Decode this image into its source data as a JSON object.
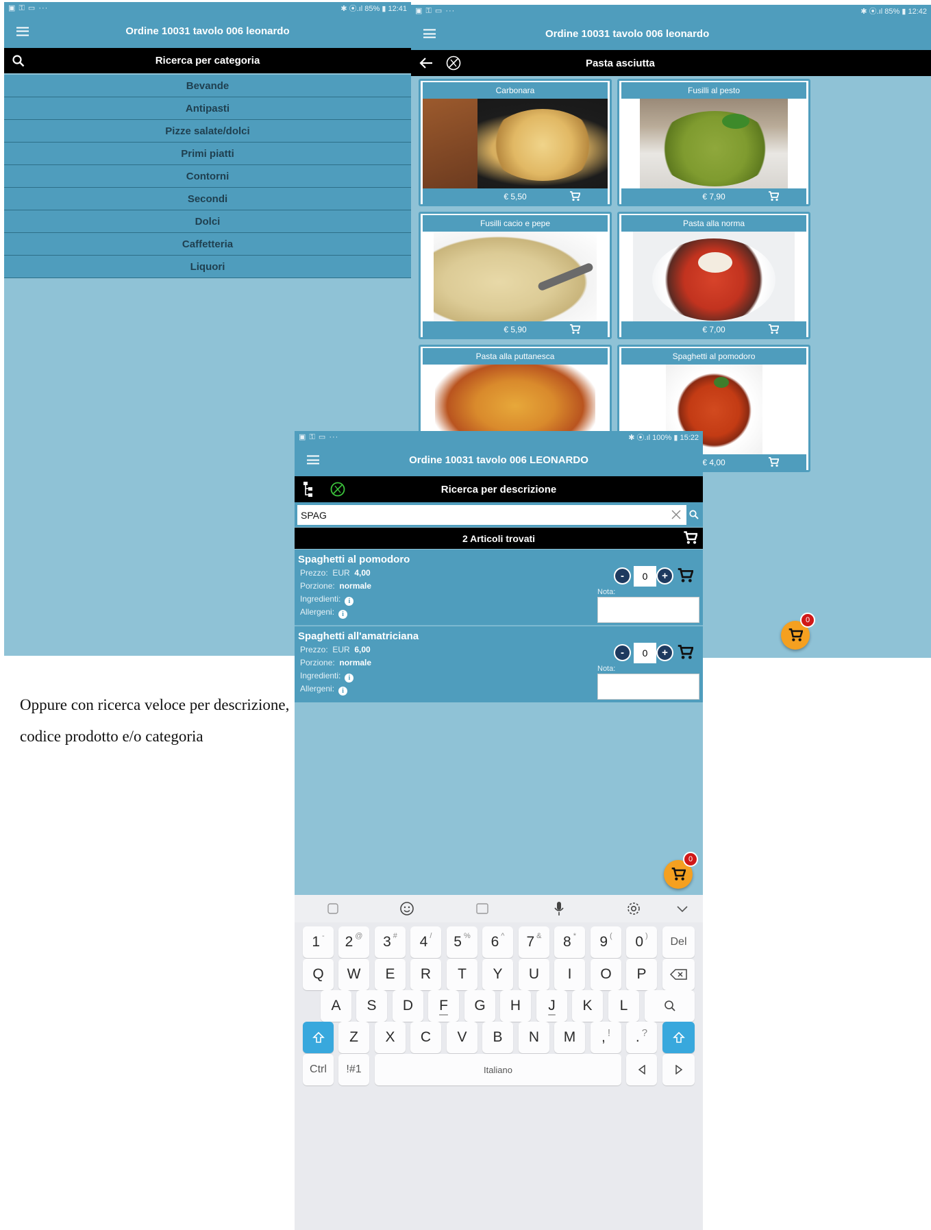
{
  "screen1": {
    "status_left": "▣ ⚿ ▭ ···",
    "status_right": "✱ ⦿.ıl 85% ▮ 12:41",
    "title": "Ordine 10031 tavolo 006 leonardo",
    "subheader": "Ricerca per categoria",
    "categories": [
      "Bevande",
      "Antipasti",
      "Pizze salate/dolci",
      "Primi piatti",
      "Contorni",
      "Secondi",
      "Dolci",
      "Caffetteria",
      "Liquori"
    ]
  },
  "screen2": {
    "status_left": "▣ ⚿ ▭ ···",
    "status_right": "✱ ⦿.ıl 85% ▮ 12:42",
    "title": "Ordine 10031 tavolo 006 leonardo",
    "subheader": "Pasta asciutta",
    "products": [
      {
        "name": "Carbonara",
        "price": "€ 5,50"
      },
      {
        "name": "Fusilli al pesto",
        "price": "€ 7,90"
      },
      {
        "name": "Fusilli cacio e pepe",
        "price": "€ 5,90"
      },
      {
        "name": "Pasta alla norma",
        "price": "€ 7,00"
      },
      {
        "name": "Pasta alla puttanesca",
        "price": ""
      },
      {
        "name": "Spaghetti al pomodoro",
        "price": "€ 4,00"
      }
    ],
    "cart_count": "0"
  },
  "screen3": {
    "status_left": "▣ ⚿ ▭ ···",
    "status_right": "✱ ⦿.ıl 100% ▮ 15:22",
    "title": "Ordine 10031 tavolo 006 LEONARDO",
    "subheader": "Ricerca per descrizione",
    "search_value": "SPAG",
    "results_label": "2 Articoli trovati",
    "results": [
      {
        "name": "Spaghetti al pomodoro",
        "price_label": "Prezzo:",
        "currency": "EUR",
        "price": "4,00",
        "portion_label": "Porzione:",
        "portion": "normale",
        "ingredients_label": "Ingredienti:",
        "allergens_label": "Allergeni:",
        "qty": "0",
        "note_label": "Nota:"
      },
      {
        "name": "Spaghetti all'amatriciana",
        "price_label": "Prezzo:",
        "currency": "EUR",
        "price": "6,00",
        "portion_label": "Porzione:",
        "portion": "normale",
        "ingredients_label": "Ingredienti:",
        "allergens_label": "Allergeni:",
        "qty": "0",
        "note_label": "Nota:"
      }
    ],
    "cart_count": "0",
    "keyboard": {
      "row1": [
        [
          "1",
          "-"
        ],
        [
          "2",
          "@"
        ],
        [
          "3",
          "#"
        ],
        [
          "4",
          "/"
        ],
        [
          "5",
          "%"
        ],
        [
          "6",
          "^"
        ],
        [
          "7",
          "&"
        ],
        [
          "8",
          "*"
        ],
        [
          "9",
          "("
        ],
        [
          "0",
          ")"
        ]
      ],
      "del": "Del",
      "row2": [
        "Q",
        "W",
        "E",
        "R",
        "T",
        "Y",
        "U",
        "I",
        "O",
        "P"
      ],
      "row3": [
        "A",
        "S",
        "D",
        "F",
        "G",
        "H",
        "J",
        "K",
        "L"
      ],
      "row4": [
        "Z",
        "X",
        "C",
        "V",
        "B",
        "N",
        "M"
      ],
      "comma": [
        ",",
        "!"
      ],
      "period": [
        ".",
        "?"
      ],
      "ctrl": "Ctrl",
      "symbols": "!#1",
      "space": "Italiano"
    }
  },
  "caption": {
    "line1": "Oppure con ricerca veloce per descrizione,",
    "line2": "codice prodotto e/o categoria"
  }
}
